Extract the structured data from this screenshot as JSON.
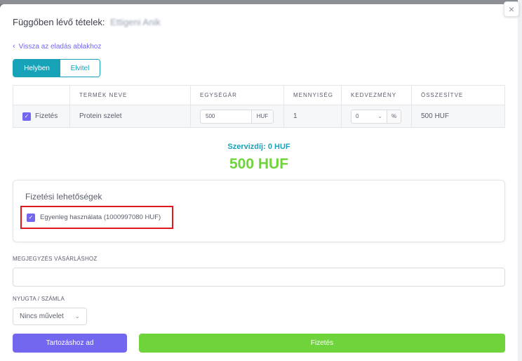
{
  "modal": {
    "title": "Függőben lévő tételek:",
    "customer_name": "Ettigeni Anik",
    "back_link": "Vissza az eladás ablakhoz",
    "close_icon": "×"
  },
  "mode_toggle": {
    "options": [
      "Helyben",
      "Elvitel"
    ],
    "selected": "Helyben"
  },
  "items_table": {
    "headers": [
      "",
      "TERMÉK NEVE",
      "EGYSÉGÁR",
      "MENNYISÉG",
      "KEDVEZMÉNY",
      "ÖSSZESÍTVE"
    ],
    "rows": [
      {
        "pay_label": "Fizetés",
        "pay_checked": true,
        "product": "Protein szelet",
        "unit_price": "500",
        "currency": "HUF",
        "quantity": "1",
        "discount": "0",
        "discount_unit": "%",
        "total": "500 HUF"
      }
    ]
  },
  "summary": {
    "service_fee": "Szervizdíj: 0 HUF",
    "total": "500 HUF"
  },
  "payment_options": {
    "title": "Fizetési lehetőségek",
    "balance_label": "Egyenleg használata (1000997080 HUF)",
    "balance_checked": true
  },
  "note": {
    "label": "MEGJEGYZÉS VÁSÁRLÁSHOZ",
    "value": ""
  },
  "receipt": {
    "label": "NYUGTA / SZÁMLA",
    "selected": "Nincs művelet"
  },
  "buttons": {
    "debt": "Tartozáshoz ad",
    "pay": "Fizetés"
  },
  "colors": {
    "primary": "#7367f0",
    "info": "#17a2b8",
    "success": "#6fd33b",
    "highlight": "#e0191f"
  }
}
